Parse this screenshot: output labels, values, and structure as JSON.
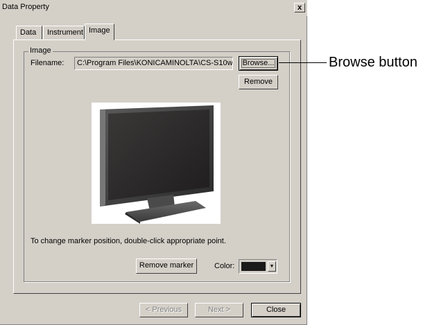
{
  "window": {
    "title": "Data Property",
    "close_glyph": "x"
  },
  "tabs": [
    {
      "label": "Data"
    },
    {
      "label": "Instrument"
    },
    {
      "label": "Image"
    }
  ],
  "image_group": {
    "legend": "Image",
    "filename_label": "Filename:",
    "filename_value": "C:\\Program Files\\KONICAMINOLTA\\CS-S10w\\",
    "browse_label": "Browse...",
    "remove_label": "Remove",
    "hint": "To change marker position, double-click appropriate point.",
    "remove_marker_label": "Remove marker",
    "color_label": "Color:",
    "color_value": "#1a1a1a",
    "dropdown_glyph": "▼"
  },
  "footer": {
    "previous_label": "< Previous",
    "next_label": "Next >",
    "close_label": "Close"
  },
  "annotation": {
    "label": "Browse button"
  }
}
